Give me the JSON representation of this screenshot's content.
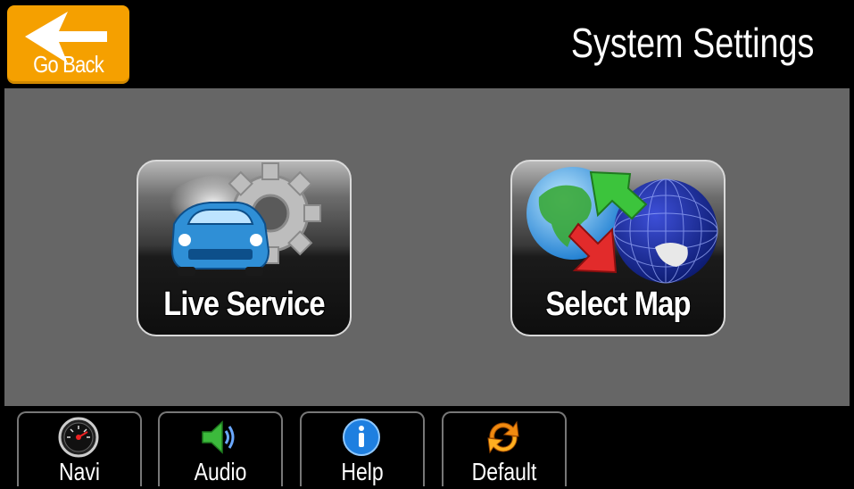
{
  "header": {
    "back_label": "Go Back",
    "title": "System Settings"
  },
  "tiles": [
    {
      "label": "Live Service",
      "icon": "car-gear-icon"
    },
    {
      "label": "Select Map",
      "icon": "globe-arrows-icon"
    }
  ],
  "footer": {
    "buttons": [
      {
        "label": "Navi",
        "icon": "speedometer-icon"
      },
      {
        "label": "Audio",
        "icon": "speaker-icon"
      },
      {
        "label": "Help",
        "icon": "info-icon"
      },
      {
        "label": "Default",
        "icon": "refresh-icon"
      }
    ]
  },
  "colors": {
    "accent": "#f5a000",
    "content_bg": "#666666"
  }
}
